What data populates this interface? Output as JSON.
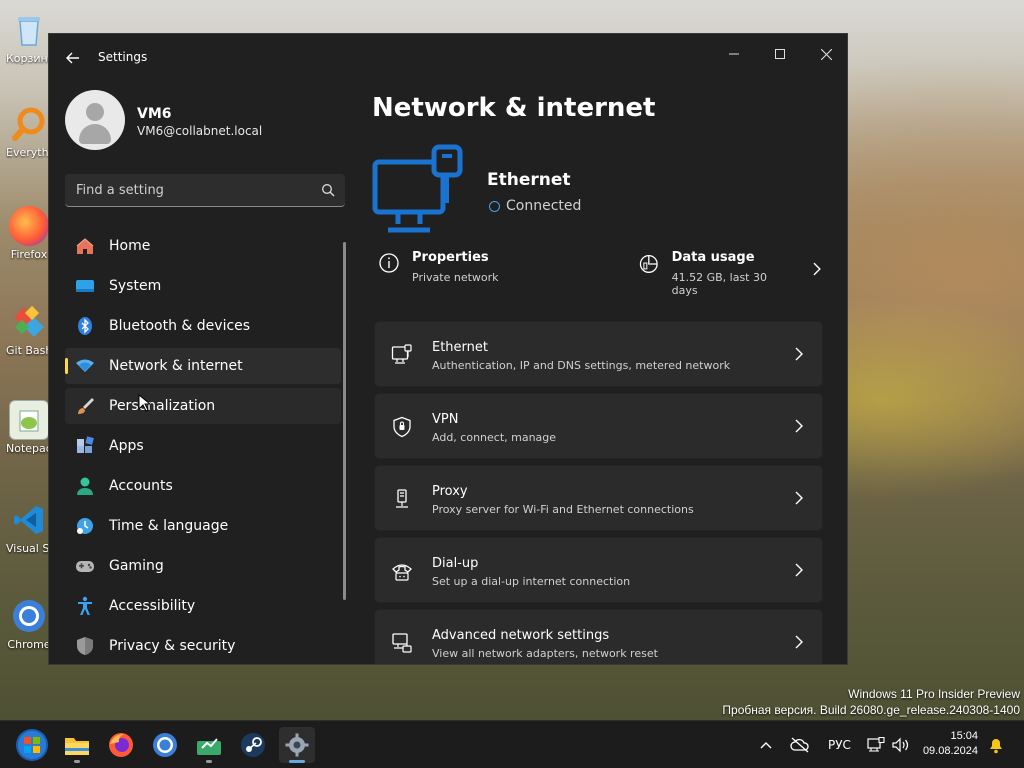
{
  "desktop": {
    "icons": [
      {
        "label": "Корзина",
        "icon": "recycle-bin-icon"
      },
      {
        "label": "Everything",
        "icon": "everything-search-icon"
      },
      {
        "label": "Firefox",
        "icon": "firefox-icon"
      },
      {
        "label": "Git Bash",
        "icon": "git-bash-icon"
      },
      {
        "label": "Notepad++",
        "icon": "notepad-plus-plus-icon"
      },
      {
        "label": "Visual Studio Code",
        "icon": "vscode-icon"
      },
      {
        "label": "Chrome",
        "icon": "chrome-icon"
      }
    ],
    "watermark": {
      "line1": "Windows 11 Pro Insider Preview",
      "line2": "Пробная версия. Build 26080.ge_release.240308-1400"
    }
  },
  "window": {
    "title": "Settings",
    "controls": {
      "minimize": "—",
      "maximize": "☐",
      "close": "✕"
    }
  },
  "profile": {
    "name": "VM6",
    "email": "VM6@collabnet.local"
  },
  "search": {
    "placeholder": "Find a setting"
  },
  "nav": [
    {
      "label": "Home",
      "icon": "home-icon",
      "color": "#e66a3a"
    },
    {
      "label": "System",
      "icon": "system-display-icon",
      "color": "#2ea2e8"
    },
    {
      "label": "Bluetooth & devices",
      "icon": "bluetooth-icon",
      "color": "#3b8de0"
    },
    {
      "label": "Network & internet",
      "icon": "network-wifi-icon",
      "color": "#6fb8f0",
      "active": true
    },
    {
      "label": "Personalization",
      "icon": "paintbrush-icon",
      "color": "#e0a060"
    },
    {
      "label": "Apps",
      "icon": "apps-icon",
      "color": "#8ab4e8"
    },
    {
      "label": "Accounts",
      "icon": "accounts-icon",
      "color": "#3cc39a"
    },
    {
      "label": "Time & language",
      "icon": "time-language-icon",
      "color": "#47a8e8"
    },
    {
      "label": "Gaming",
      "icon": "gaming-controller-icon",
      "color": "#b0b0b0"
    },
    {
      "label": "Accessibility",
      "icon": "accessibility-icon",
      "color": "#4aa8f0"
    },
    {
      "label": "Privacy & security",
      "icon": "shield-icon",
      "color": "#9a9a9a"
    }
  ],
  "main": {
    "page_title": "Network & internet",
    "hero": {
      "title": "Ethernet",
      "status": "Connected",
      "accent": "#1a73d0"
    },
    "properties": {
      "title": "Properties",
      "subtitle": "Private network"
    },
    "data_usage": {
      "title": "Data usage",
      "subtitle": "41.52 GB, last 30 days"
    },
    "cards": [
      {
        "title": "Ethernet",
        "subtitle": "Authentication, IP and DNS settings, metered network",
        "icon": "ethernet-icon"
      },
      {
        "title": "VPN",
        "subtitle": "Add, connect, manage",
        "icon": "vpn-shield-icon"
      },
      {
        "title": "Proxy",
        "subtitle": "Proxy server for Wi-Fi and Ethernet connections",
        "icon": "proxy-icon"
      },
      {
        "title": "Dial-up",
        "subtitle": "Set up a dial-up internet connection",
        "icon": "dial-up-icon"
      },
      {
        "title": "Advanced network settings",
        "subtitle": "View all network adapters, network reset",
        "icon": "advanced-network-icon"
      }
    ]
  },
  "taskbar": {
    "apps": [
      {
        "name": "start-button",
        "icon": "windows-start-icon"
      },
      {
        "name": "file-explorer",
        "icon": "folder-icon"
      },
      {
        "name": "firefox",
        "icon": "firefox-icon"
      },
      {
        "name": "chrome",
        "icon": "chrome-icon"
      },
      {
        "name": "app-green",
        "icon": "app-icon"
      },
      {
        "name": "steam",
        "icon": "steam-icon"
      },
      {
        "name": "settings",
        "icon": "gear-icon",
        "active": true
      }
    ],
    "tray": {
      "language": "РУС",
      "time": "15:04",
      "date": "09.08.2024"
    }
  }
}
